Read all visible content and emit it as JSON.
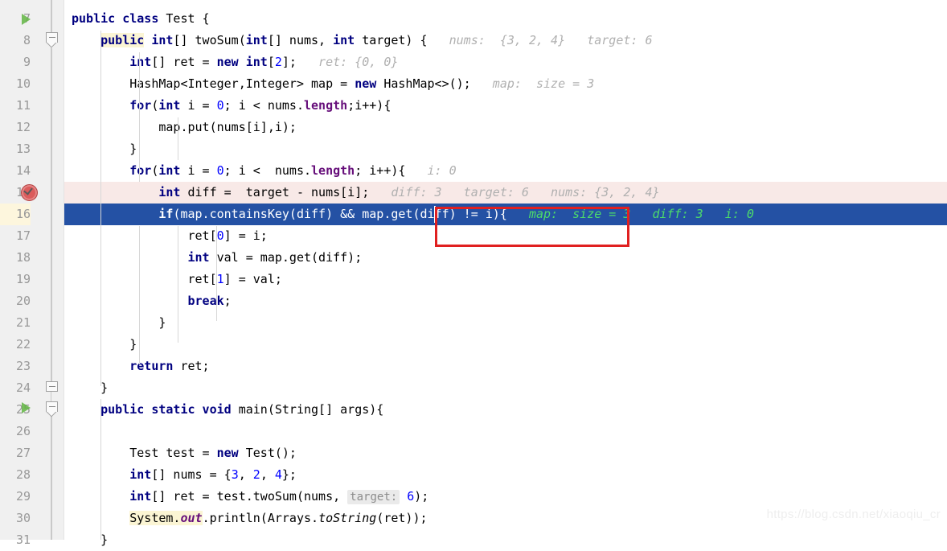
{
  "editor": {
    "file_language": "Java",
    "watermark": "https://blog.csdn.net/xiaoqiu_cr",
    "colors": {
      "gutter_bg": "#f0f0f0",
      "line_number": "#999999",
      "keyword": "#000080",
      "number": "#0000ff",
      "field": "#660e7a",
      "inline_hint": "#b0b0b0",
      "inline_hint_selected": "#4ddc6a",
      "execution_line_bg": "#2451a4",
      "breakpoint_line_bg": "#f8e9e7",
      "caret_row_gutter_bg": "#fdf6dd",
      "annotation_rect": "#e02020",
      "run_marker": "#62b543",
      "breakpoint": "#db5c5c"
    },
    "gutter": {
      "line_numbers": [
        "7",
        "8",
        "9",
        "10",
        "11",
        "12",
        "13",
        "14",
        "15",
        "16",
        "17",
        "18",
        "19",
        "20",
        "21",
        "22",
        "23",
        "24",
        "25",
        "26",
        "27",
        "28",
        "29",
        "30",
        "31"
      ],
      "run_marker_lines": [
        "7",
        "25"
      ],
      "breakpoint_lines": [
        "15"
      ],
      "fold_marker_lines": [
        "8",
        "24",
        "25"
      ],
      "current_line": "16"
    },
    "lines": [
      {
        "number": "7",
        "text": "public class Test {",
        "hint": ""
      },
      {
        "number": "8",
        "text": "    public int[] twoSum(int[] nums, int target) {",
        "hint": "nums:  {3, 2, 4}   target: 6"
      },
      {
        "number": "9",
        "text": "        int[] ret = new int[2];",
        "hint": "ret: {0, 0}"
      },
      {
        "number": "10",
        "text": "        HashMap<Integer,Integer> map = new HashMap<>();",
        "hint": "map:  size = 3"
      },
      {
        "number": "11",
        "text": "        for(int i = 0; i < nums.length;i++){",
        "hint": ""
      },
      {
        "number": "12",
        "text": "            map.put(nums[i],i);",
        "hint": ""
      },
      {
        "number": "13",
        "text": "        }",
        "hint": ""
      },
      {
        "number": "14",
        "text": "        for(int i = 0; i <  nums.length; i++){",
        "hint": "i: 0"
      },
      {
        "number": "15",
        "text": "            int diff =  target - nums[i];",
        "hint": "diff: 3   target: 6   nums: {3, 2, 4}"
      },
      {
        "number": "16",
        "text": "            if(map.containsKey(diff) && map.get(diff) != i){",
        "hint": "map:  size = 3   diff: 3   i: 0"
      },
      {
        "number": "17",
        "text": "                ret[0] = i;",
        "hint": ""
      },
      {
        "number": "18",
        "text": "                int val = map.get(diff);",
        "hint": ""
      },
      {
        "number": "19",
        "text": "                ret[1] = val;",
        "hint": ""
      },
      {
        "number": "20",
        "text": "                break;",
        "hint": ""
      },
      {
        "number": "21",
        "text": "            }",
        "hint": ""
      },
      {
        "number": "22",
        "text": "        }",
        "hint": ""
      },
      {
        "number": "23",
        "text": "        return ret;",
        "hint": ""
      },
      {
        "number": "24",
        "text": "    }",
        "hint": ""
      },
      {
        "number": "25",
        "text": "    public static void main(String[] args){",
        "hint": ""
      },
      {
        "number": "26",
        "text": "",
        "hint": ""
      },
      {
        "number": "27",
        "text": "        Test test = new Test();",
        "hint": ""
      },
      {
        "number": "28",
        "text": "        int[] nums = {3, 2, 4};",
        "hint": ""
      },
      {
        "number": "29",
        "text": "        int[] ret = test.twoSum(nums,  target: 6);",
        "hint": ""
      },
      {
        "number": "30",
        "text": "        System.out.println(Arrays.toString(ret));",
        "hint": ""
      },
      {
        "number": "31",
        "text": "    }",
        "hint": ""
      }
    ],
    "parameter_hints": [
      {
        "line": "29",
        "label": "target:",
        "value": "6"
      }
    ],
    "annotation": {
      "shape": "rectangle",
      "color": "#e02020",
      "covers_text": "map.get(diff) != i"
    },
    "tokens": {
      "l7": [
        {
          "t": "public",
          "c": "kw"
        },
        {
          "t": " ",
          "c": "plain"
        },
        {
          "t": "class",
          "c": "kw"
        },
        {
          "t": " Test {",
          "c": "plain"
        }
      ],
      "l8_kw1": "public",
      "l8_rest": " int[] twoSum(int[] nums, int target) {",
      "l9": "int[] ret = new int[2];",
      "l10": "HashMap<Integer,Integer> map = new HashMap<>();",
      "l11": "for(int i = 0; i < nums.length;i++){",
      "l12": "map.put(nums[i],i);",
      "l14": "for(int i = 0; i <  nums.length; i++){",
      "l15": "int diff =  target - nums[i];",
      "l16": "if(map.containsKey(diff) && map.get(diff) != i){",
      "l17": "ret[0] = i;",
      "l18": "int val = map.get(diff);",
      "l19": "ret[1] = val;",
      "l20": "break;",
      "l23": "return ret;",
      "l25": "public static void main(String[] args){",
      "l27": "Test test = new Test();",
      "l28": "int[] nums = {3, 2, 4};",
      "l29": "int[] ret = test.twoSum(nums,",
      "l30": "System.out.println(Arrays.toString(ret));"
    }
  }
}
